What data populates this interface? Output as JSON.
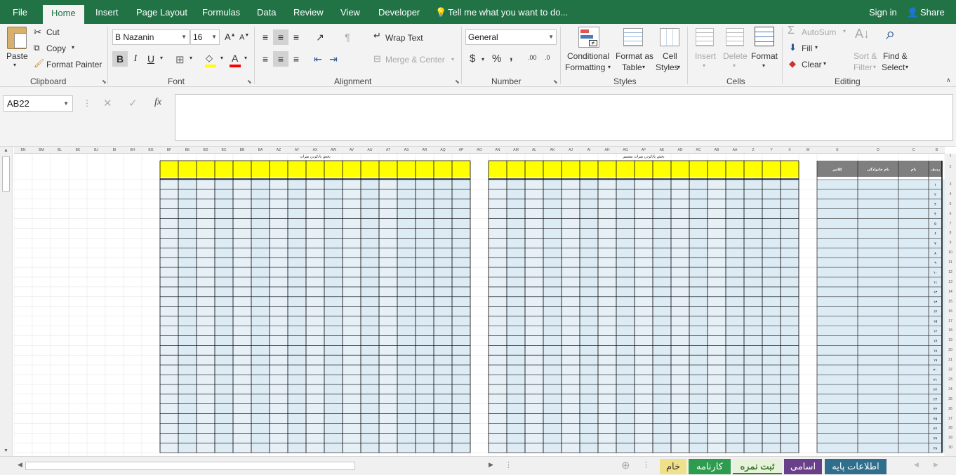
{
  "menu": {
    "tabs": [
      "File",
      "Home",
      "Insert",
      "Page Layout",
      "Formulas",
      "Data",
      "Review",
      "View",
      "Developer"
    ],
    "active": "Home",
    "tell_me": "Tell me what you want to do...",
    "sign_in": "Sign in",
    "share": "Share"
  },
  "clipboard": {
    "paste": "Paste",
    "cut": "Cut",
    "copy": "Copy",
    "format_painter": "Format Painter",
    "label": "Clipboard"
  },
  "font": {
    "name": "B Nazanin",
    "size": "16",
    "bold": "B",
    "italic": "I",
    "underline": "U",
    "label": "Font"
  },
  "alignment": {
    "wrap_text": "Wrap Text",
    "merge_center": "Merge & Center",
    "label": "Alignment"
  },
  "number": {
    "format": "General",
    "currency": "$",
    "percent": "%",
    "comma": ",",
    "inc_decimal": ".00",
    "dec_decimal": ".0",
    "label": "Number"
  },
  "styles": {
    "conditional_1": "Conditional",
    "conditional_2": "Formatting",
    "format_table_1": "Format as",
    "format_table_2": "Table",
    "cell_styles_1": "Cell",
    "cell_styles_2": "Styles",
    "label": "Styles"
  },
  "cells": {
    "insert": "Insert",
    "delete": "Delete",
    "format": "Format",
    "label": "Cells"
  },
  "editing": {
    "autosum": "AutoSum",
    "fill": "Fill",
    "clear": "Clear",
    "sort_1": "Sort &",
    "sort_2": "Filter",
    "find_1": "Find &",
    "find_2": "Select",
    "label": "Editing"
  },
  "formula_bar": {
    "name_box": "AB22",
    "fx": "fx",
    "cancel": "✕",
    "enter": "✓",
    "value": ""
  },
  "sheet": {
    "columns": [
      "BN",
      "BM",
      "BL",
      "BK",
      "BJ",
      "BI",
      "BH",
      "BG",
      "BF",
      "BE",
      "BD",
      "BC",
      "BB",
      "BA",
      "AZ",
      "AY",
      "AX",
      "AW",
      "AV",
      "AU",
      "AT",
      "AS",
      "AR",
      "AQ",
      "AP",
      "AO",
      "AN",
      "AM",
      "AL",
      "AK",
      "AJ",
      "AI",
      "AH",
      "AG",
      "AF",
      "AE",
      "AD",
      "AC",
      "AB",
      "AA",
      "Z",
      "Y",
      "X",
      "W",
      "E",
      "D",
      "C",
      "B",
      "A"
    ],
    "title_left": "بخش یادکردن نمرات",
    "title_right": "بخش یادکردن نمرات مستمر",
    "headers": {
      "radif": "ردیف",
      "nam": "نام",
      "family": "نام خانوادگی",
      "klass": "کلاس"
    },
    "row_numbers": [
      "۱",
      "۲",
      "۳",
      "۴",
      "۵",
      "۶",
      "۷",
      "۸",
      "۹",
      "۱۰",
      "۱۱",
      "۱۲",
      "۱۳",
      "۱۴",
      "۱۵",
      "۱۶",
      "۱۷",
      "۱۸",
      "۱۹",
      "۲۰",
      "۲۱",
      "۲۲",
      "۲۳",
      "۲۴",
      "۲۵",
      "۲۶",
      "۲۷",
      "۲۸"
    ],
    "excel_rows": [
      "1",
      "2",
      "3",
      "4",
      "5",
      "6",
      "7",
      "8",
      "9",
      "10",
      "11",
      "12",
      "13",
      "14",
      "15",
      "16",
      "17",
      "18",
      "19",
      "20",
      "21",
      "22",
      "23",
      "24",
      "25",
      "26",
      "27",
      "28",
      "29",
      "30"
    ]
  },
  "sheet_tabs": [
    {
      "label": "خام",
      "color": "#f0e08a",
      "text": "#333333"
    },
    {
      "label": "کارنامه",
      "color": "#2e9c4f",
      "text": "#ffffff"
    },
    {
      "label": "ثبت نمره",
      "color": "#e6f2da",
      "text": "#3d7a2b"
    },
    {
      "label": "اسامی",
      "color": "#6a3f8a",
      "text": "#ffffff"
    },
    {
      "label": "اطلاعات پایه",
      "color": "#2f6e8c",
      "text": "#ffffff"
    }
  ],
  "colors": {
    "accent": "#217346",
    "header_yellow": "#ffff00",
    "cell_fill": "#dcebf4",
    "header_gray": "#7f7f7f"
  }
}
